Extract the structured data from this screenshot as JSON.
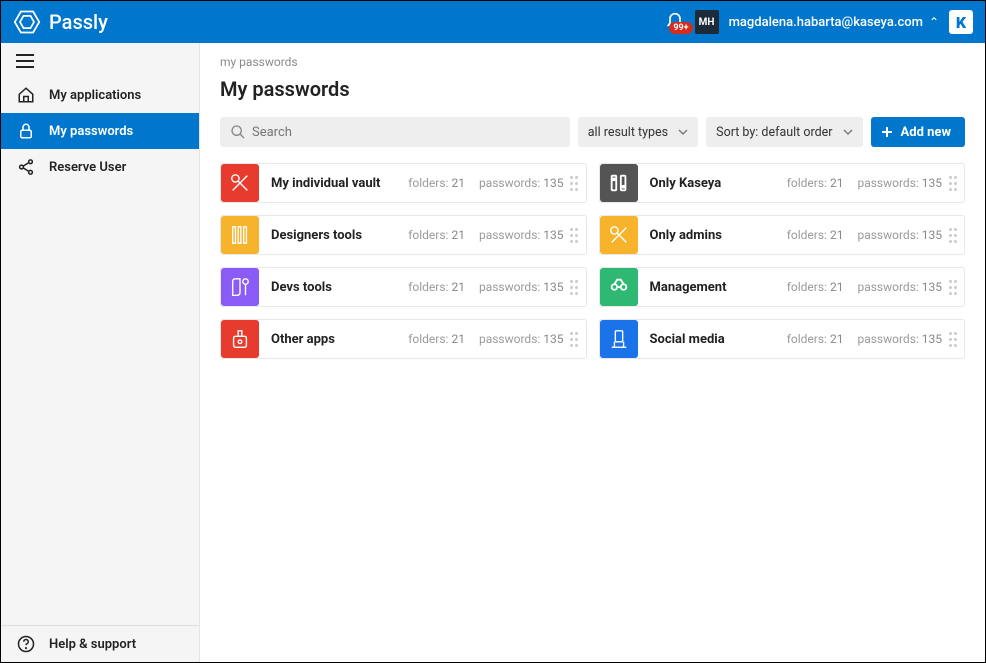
{
  "header": {
    "brand": "Passly",
    "badge": "99+",
    "avatar_initials": "MH",
    "user_email": "magdalena.habarta@kaseya.com",
    "k_label": "K"
  },
  "sidebar": {
    "items": [
      {
        "label": "My applications"
      },
      {
        "label": "My passwords"
      },
      {
        "label": "Reserve User"
      }
    ],
    "footer_label": "Help & support"
  },
  "content": {
    "breadcrumb": "my passwords",
    "title": "My passwords",
    "search_placeholder": "Search",
    "filter_label": "all result types",
    "sort_label": "Sort by: default order",
    "add_label": "Add new",
    "folders_label": "folders:",
    "passwords_label": "passwords:",
    "vaults": [
      {
        "name": "My individual vault",
        "folders": 21,
        "passwords": 135,
        "color": "#e73b2e"
      },
      {
        "name": "Only Kaseya",
        "folders": 21,
        "passwords": 135,
        "color": "#545454"
      },
      {
        "name": "Designers tools",
        "folders": 21,
        "passwords": 135,
        "color": "#f7b32b"
      },
      {
        "name": "Only admins",
        "folders": 21,
        "passwords": 135,
        "color": "#f7b32b"
      },
      {
        "name": "Devs tools",
        "folders": 21,
        "passwords": 135,
        "color": "#8a5cf5"
      },
      {
        "name": "Management",
        "folders": 21,
        "passwords": 135,
        "color": "#2eb872"
      },
      {
        "name": "Other apps",
        "folders": 21,
        "passwords": 135,
        "color": "#e73b2e"
      },
      {
        "name": "Social media",
        "folders": 21,
        "passwords": 135,
        "color": "#1a73e8"
      }
    ]
  }
}
